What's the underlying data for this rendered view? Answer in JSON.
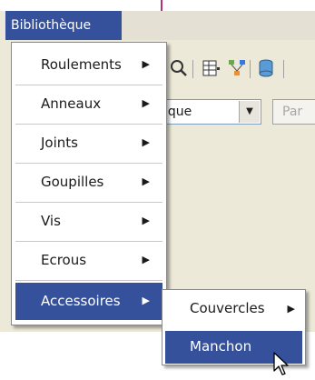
{
  "menubar": {
    "title": "Bibliothèque"
  },
  "toolbar": {
    "icons": [
      "search-icon",
      "grid-icon",
      "network-icon",
      "database-icon"
    ],
    "combo_value": "ique",
    "combo2_value": "Par"
  },
  "menu": {
    "items": [
      {
        "label": "Roulements",
        "has_submenu": true
      },
      {
        "label": "Anneaux",
        "has_submenu": true
      },
      {
        "label": "Joints",
        "has_submenu": true
      },
      {
        "label": "Goupilles",
        "has_submenu": true
      },
      {
        "label": "Vis",
        "has_submenu": true
      },
      {
        "label": "Ecrous",
        "has_submenu": true
      },
      {
        "label": "Accessoires",
        "has_submenu": true,
        "active": true
      }
    ]
  },
  "submenu": {
    "items": [
      {
        "label": "Couvercles",
        "has_submenu": true
      },
      {
        "label": "Manchon",
        "has_submenu": false,
        "active": true
      }
    ]
  },
  "colors": {
    "highlight": "#36519b",
    "pointer_line": "#b0307a",
    "app_background": "#ece9d8"
  }
}
